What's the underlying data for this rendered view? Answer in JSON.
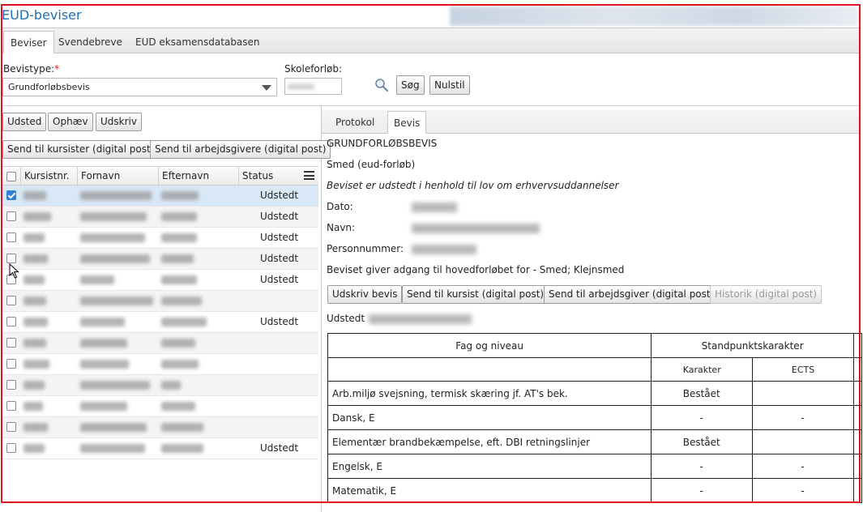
{
  "app": {
    "title": "EUD-beviser"
  },
  "tabs": [
    "Beviser",
    "Svendebreve",
    "EUD eksamensdatabasen"
  ],
  "filters": {
    "bevistype_label": "Bevistype:",
    "required_marker": "*",
    "bevistype_value": "Grundforløbsbevis",
    "skoleforlob_label": "Skoleforløb:",
    "search_label": "Søg",
    "reset_label": "Nulstil"
  },
  "left_toolbar": {
    "udsted": "Udsted",
    "ophaev": "Ophæv",
    "udskriv": "Udskriv",
    "send_kursister": "Send til kursister (digital post)",
    "send_arbejdsgivere": "Send til arbejdsgivere (digital post)"
  },
  "grid": {
    "columns": [
      "Kursistnr.",
      "Fornavn",
      "Efternavn",
      "Status"
    ],
    "rows": [
      {
        "checked": true,
        "status": "Udstedt"
      },
      {
        "checked": false,
        "status": "Udstedt"
      },
      {
        "checked": false,
        "status": "Udstedt"
      },
      {
        "checked": false,
        "status": "Udstedt"
      },
      {
        "checked": false,
        "status": "Udstedt"
      },
      {
        "checked": false,
        "status": ""
      },
      {
        "checked": false,
        "status": "Udstedt"
      },
      {
        "checked": false,
        "status": ""
      },
      {
        "checked": false,
        "status": ""
      },
      {
        "checked": false,
        "status": ""
      },
      {
        "checked": false,
        "status": ""
      },
      {
        "checked": false,
        "status": ""
      },
      {
        "checked": false,
        "status": "Udstedt"
      }
    ]
  },
  "right_tabs": [
    "Protokol",
    "Bevis"
  ],
  "certificate": {
    "heading": "GRUNDFORLØBSBEVIS",
    "program": "Smed (eud-forløb)",
    "legal_note": "Beviset er udstedt i henhold til lov om erhvervsuddannelser",
    "dato_label": "Dato:",
    "navn_label": "Navn:",
    "personnummer_label": "Personnummer:",
    "access_text": "Beviset giver adgang til hovedforløbet for - Smed; Klejnsmed",
    "udstedt_label": "Udstedt"
  },
  "cert_actions": {
    "udskriv": "Udskriv bevis",
    "send_kursist": "Send til kursist (digital post)",
    "send_arbejdsgiver": "Send til arbejdsgiver (digital post)",
    "historik": "Historik (digital post)"
  },
  "grades_table": {
    "col_fag": "Fag og niveau",
    "col_standpunkt": "Standpunktskarakter",
    "sub_karakter": "Karakter",
    "sub_ects": "ECTS",
    "rows": [
      {
        "fag": "Arb.miljø svejsning, termisk skæring jf. AT's bek.",
        "karakter": "Bestået",
        "ects": ""
      },
      {
        "fag": "Dansk, E",
        "karakter": "-",
        "ects": "-"
      },
      {
        "fag": "Elementær brandbekæmpelse, eft. DBI retningslinjer",
        "karakter": "Bestået",
        "ects": ""
      },
      {
        "fag": "Engelsk, E",
        "karakter": "-",
        "ects": "-"
      },
      {
        "fag": "Matematik, E",
        "karakter": "-",
        "ects": "-"
      }
    ]
  },
  "icons": {
    "search": "search-icon",
    "menu": "menu-icon",
    "dropdown": "chevron-down-icon",
    "cursor": "mouse-cursor-icon"
  }
}
